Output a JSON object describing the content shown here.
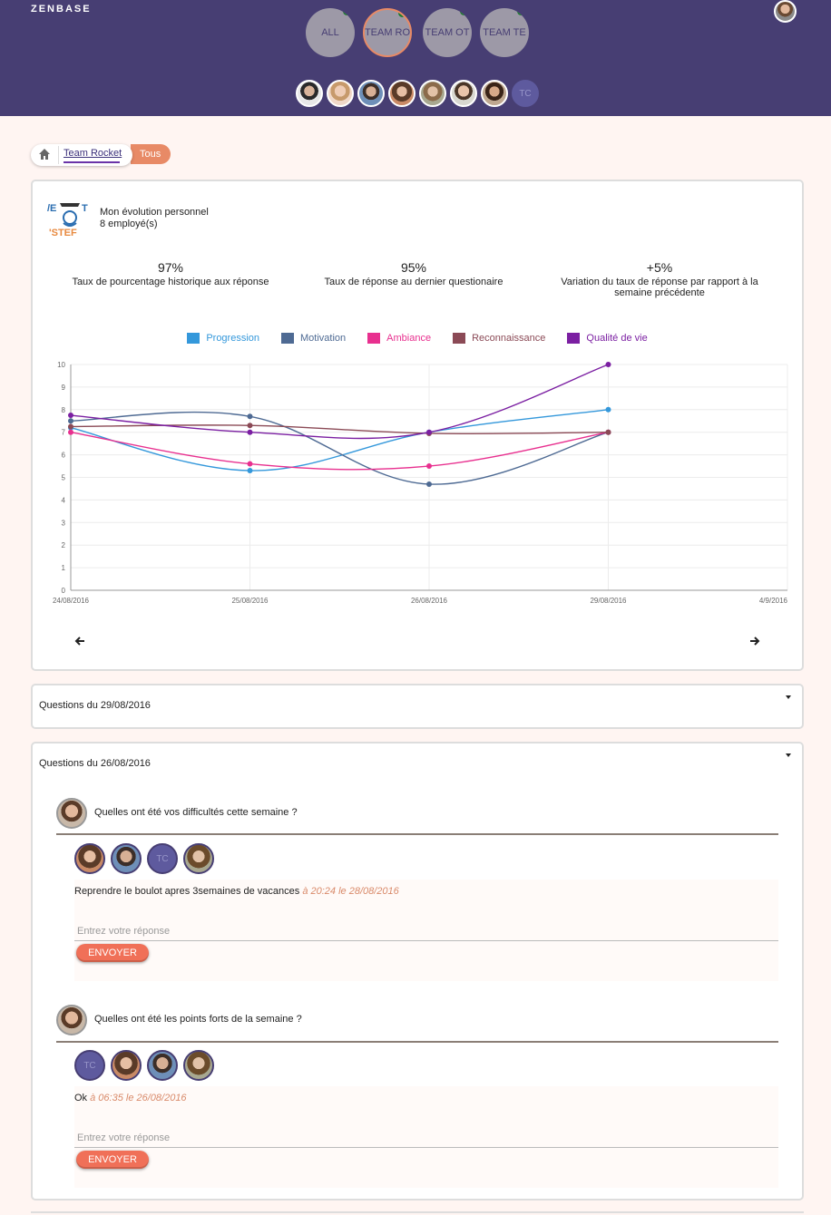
{
  "header": {
    "brand": "ZENBASE",
    "teams": [
      {
        "label": "ALL",
        "active": false
      },
      {
        "label": "TEAM RO",
        "active": true
      },
      {
        "label": "TEAM OT",
        "active": false
      },
      {
        "label": "TEAM TE",
        "active": false
      }
    ],
    "member_initials": "TC"
  },
  "breadcrumb": {
    "team": "Team Rocket",
    "filter": "Tous"
  },
  "overview": {
    "title": "Mon évolution personnel",
    "subtitle": "8 employé(s)",
    "stats": [
      {
        "value": "97%",
        "label": "Taux de pourcentage historique aux réponse"
      },
      {
        "value": "95%",
        "label": "Taux de réponse au dernier questionaire"
      },
      {
        "value": "+5%",
        "label": "Variation du taux de réponse par rapport à la semaine précédente"
      }
    ]
  },
  "chart_data": {
    "type": "line",
    "categories": [
      "24/08/2016",
      "25/08/2016",
      "26/08/2016",
      "29/08/2016",
      "4/9/2016"
    ],
    "ylim": [
      0,
      10
    ],
    "yticks": [
      0,
      1,
      2,
      3,
      4,
      5,
      6,
      7,
      8,
      9,
      10
    ],
    "legend_position": "top",
    "grid": true,
    "series": [
      {
        "name": "Progression",
        "color": "#3498db",
        "values": [
          7.2,
          5.3,
          7.0,
          8.0
        ]
      },
      {
        "name": "Motivation",
        "color": "#4e6a93",
        "values": [
          7.5,
          7.7,
          4.7,
          7.0
        ]
      },
      {
        "name": "Ambiance",
        "color": "#e8308f",
        "values": [
          7.0,
          5.6,
          5.5,
          7.0
        ]
      },
      {
        "name": "Reconnaissance",
        "color": "#8b4a56",
        "values": [
          7.25,
          7.3,
          6.95,
          7.0
        ]
      },
      {
        "name": "Qualité de vie",
        "color": "#7b1fa2",
        "values": [
          7.75,
          7.0,
          7.0,
          10.0
        ]
      }
    ]
  },
  "sections": [
    {
      "title": "Questions du 29/08/2016"
    },
    {
      "title": "Questions du 26/08/2016",
      "questions": [
        {
          "text": "Quelles ont été vos difficultés cette semaine ?",
          "response_text": "Reprendre le boulot apres 3semaines de vacances",
          "response_time": "à 20:24 le 28/08/2016",
          "placeholder": "Entrez votre réponse",
          "send_label": "ENVOYER"
        },
        {
          "text": "Quelles ont été les points forts de la semaine ?",
          "response_text": "Ok",
          "response_time": "à 06:35 le 26/08/2016",
          "placeholder": "Entrez votre réponse",
          "send_label": "ENVOYER"
        }
      ]
    }
  ]
}
